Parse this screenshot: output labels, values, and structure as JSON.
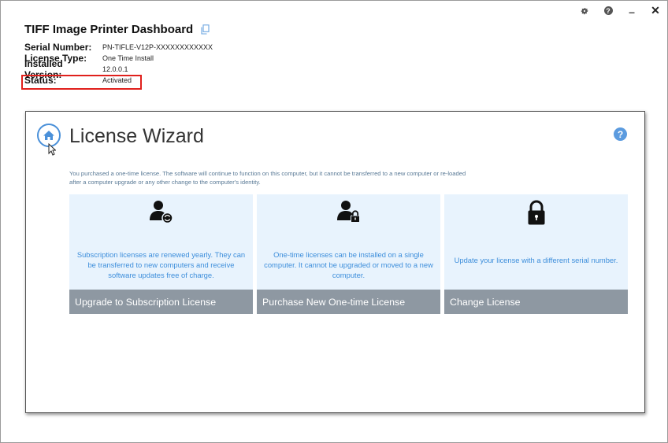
{
  "window": {
    "controls": [
      "settings",
      "help",
      "minimize",
      "close"
    ]
  },
  "header": {
    "title": "TIFF Image Printer Dashboard",
    "copy_icon": "copy-icon"
  },
  "info": {
    "serial_label": "Serial Number:",
    "serial_value": "PN-TIFLE-V12P-XXXXXXXXXXXX",
    "license_type_label": "License Type:",
    "license_type_value": "One Time Install",
    "version_label": "Installed Version:",
    "version_value": "12.0.0.1",
    "status_label": "Status:",
    "status_value": "Activated",
    "highlight_color": "#e0201c"
  },
  "wizard": {
    "title": "License Wizard",
    "description": "You purchased a one-time license. The software will continue to function on this computer, but it cannot be transferred to a new computer or re-loaded after a computer upgrade or any other change to the computer's identity.",
    "accent_color": "#4a90d9",
    "cards": [
      {
        "icon": "user-refresh-icon",
        "text": "Subscription licenses are renewed yearly. They can be transferred to new computers and receive software updates free of charge.",
        "action": "Upgrade to Subscription License"
      },
      {
        "icon": "user-lock-icon",
        "text": "One-time licenses can be installed on a single computer. It cannot be upgraded or moved to a new computer.",
        "action": "Purchase New One-time License"
      },
      {
        "icon": "padlock-icon",
        "text": "Update your license with a different serial number.",
        "action": "Change License"
      }
    ],
    "card_bg_color": "#e8f3fd",
    "card_footer_color": "#8e98a2",
    "card_text_color": "#3d8edb"
  }
}
